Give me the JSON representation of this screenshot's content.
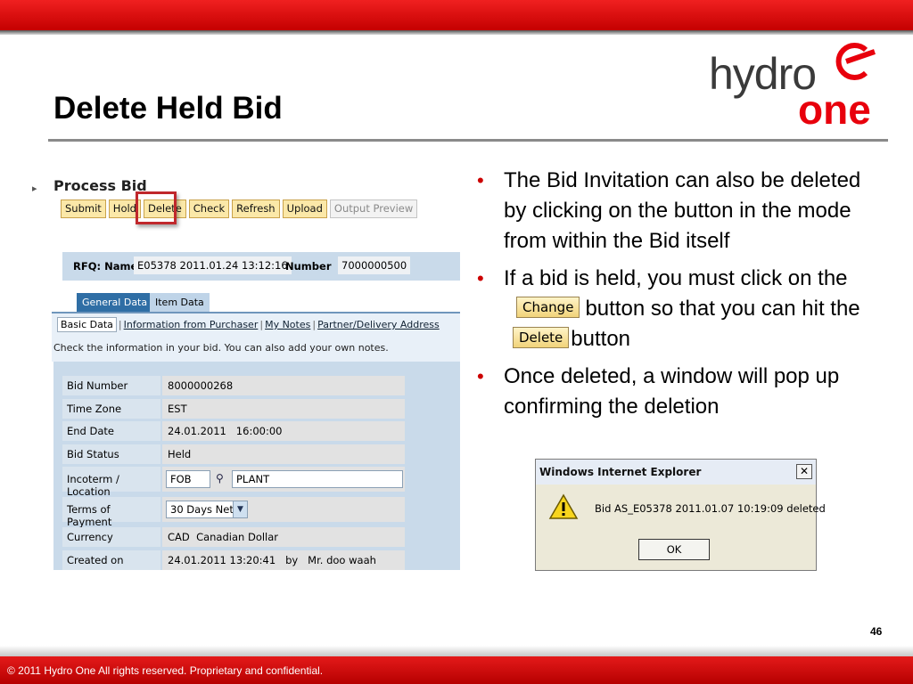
{
  "slide": {
    "title": "Delete Held Bid",
    "page_number": "46",
    "footer": "© 2011 Hydro One All rights reserved. Proprietary and confidential."
  },
  "logo": {
    "top": "hydro",
    "bottom": "one"
  },
  "sap": {
    "title": "Process Bid",
    "buttons": [
      "Submit",
      "Hold",
      "Delete",
      "Check",
      "Refresh",
      "Upload",
      "Output Preview"
    ],
    "rfq_label": "RFQ: Name",
    "rfq_name": "E05378 2011.01.24 13:12:16",
    "number_label": "Number",
    "number": "7000000500",
    "tabs": [
      "General Data",
      "Item Data"
    ],
    "subtabs": [
      "Basic Data",
      "Information from Purchaser",
      "My Notes",
      "Partner/Delivery Address"
    ],
    "info": "Check the information in your bid. You can also add your own notes.",
    "fields": {
      "bid_number": {
        "label": "Bid Number",
        "value": "8000000268"
      },
      "time_zone": {
        "label": "Time Zone",
        "value": "EST"
      },
      "end_date": {
        "label": "End Date",
        "value": "24.01.2011   16:00:00"
      },
      "bid_status": {
        "label": "Bid Status",
        "value": "Held"
      },
      "incoterm": {
        "label": "Incoterm / Location",
        "value1": "FOB",
        "value2": "PLANT"
      },
      "terms": {
        "label": "Terms of Payment",
        "value": "30 Days Net"
      },
      "currency": {
        "label": "Currency",
        "value": "CAD  Canadian Dollar"
      },
      "created_on": {
        "label": "Created on",
        "value": "24.01.2011 13:20:41   by   Mr. doo waah"
      }
    }
  },
  "bullets": {
    "b1": "The Bid Invitation can also be deleted by clicking on the button in the mode from within the Bid itself",
    "b2_part1": "If a bid is held, you must click on the",
    "b2_btn_change": "Change",
    "b2_part2": "button so that you can hit the",
    "b2_btn_delete": "Delete",
    "b2_part3": "button",
    "b3": "Once deleted, a window will pop up confirming the deletion"
  },
  "dialog": {
    "title": "Windows Internet Explorer",
    "message": "Bid AS_E05378 2011.01.07 10:19:09 deleted",
    "ok": "OK",
    "close_icon": "✕"
  },
  "colors": {
    "brand_red": "#e8000c",
    "sap_button": "#fbe8a8",
    "sap_tab_active": "#2f6ea5"
  }
}
